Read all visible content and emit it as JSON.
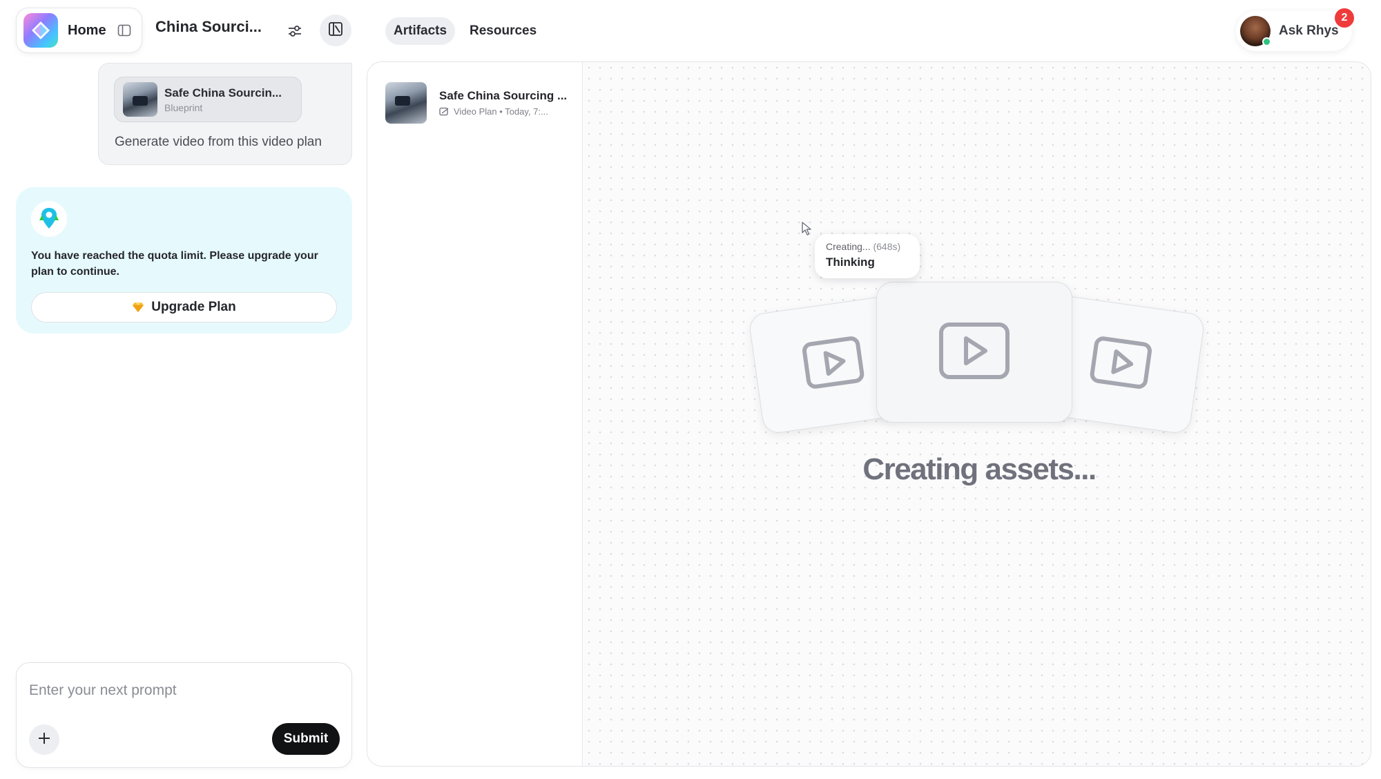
{
  "header": {
    "home_label": "Home",
    "project_title": "China Sourci...",
    "tabs": [
      {
        "label": "Artifacts",
        "active": true
      },
      {
        "label": "Resources",
        "active": false
      }
    ],
    "ask_label": "Ask Rhys",
    "notification_count": "2"
  },
  "chat": {
    "user_message": {
      "attachment_title": "Safe China Sourcin...",
      "attachment_subtitle": "Blueprint",
      "text": "Generate video from this video plan"
    },
    "quota": {
      "message": "You have reached the quota limit. Please upgrade your plan to continue.",
      "button_label": "Upgrade Plan"
    },
    "prompt": {
      "placeholder": "Enter your next prompt",
      "submit_label": "Submit"
    }
  },
  "artifacts": [
    {
      "title": "Safe China Sourcing ...",
      "meta": "Video Plan • Today, 7:..."
    }
  ],
  "canvas": {
    "status_label": "Creating...",
    "status_elapsed": "(648s)",
    "status_main": "Thinking",
    "creating_text": "Creating assets..."
  },
  "icons": {
    "app_logo": "diamond-logo-icon",
    "sidebar_toggle": "sidebar-toggle-icon",
    "sliders": "sliders-icon",
    "panel": "panel-layout-icon",
    "gem": "gem-icon",
    "plus": "plus-icon",
    "video": "video-play-icon"
  },
  "colors": {
    "accent_dark": "#111214",
    "quota_bg": "#e6fafd",
    "badge_red": "#ef3b3b",
    "gem_gold": "#f5b92e"
  }
}
